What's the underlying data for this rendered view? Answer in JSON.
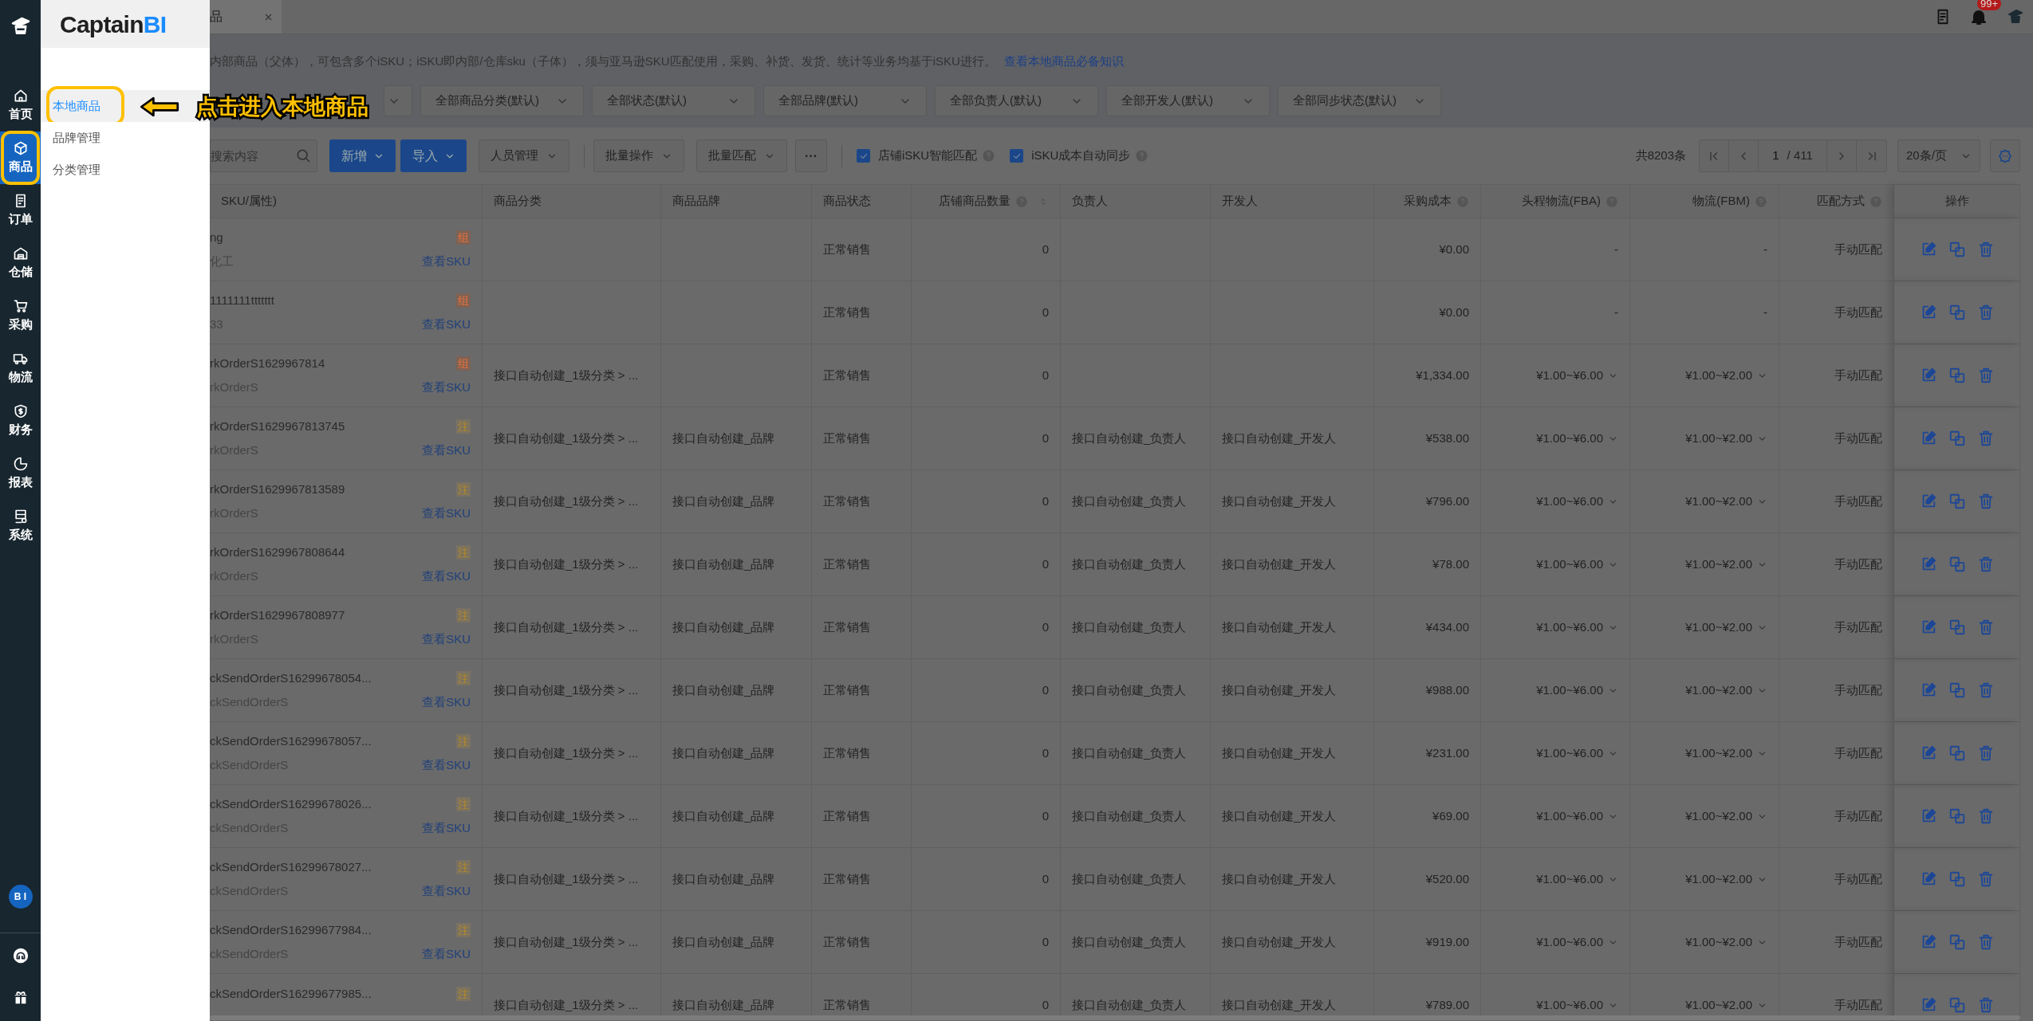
{
  "rail": {
    "items": [
      {
        "label": "首页",
        "selected": false
      },
      {
        "label": "商品",
        "selected": true
      },
      {
        "label": "订单",
        "selected": false
      },
      {
        "label": "仓储",
        "selected": false
      },
      {
        "label": "采购",
        "selected": false
      },
      {
        "label": "物流",
        "selected": false
      },
      {
        "label": "财务",
        "selected": false
      },
      {
        "label": "报表",
        "selected": false
      },
      {
        "label": "系统",
        "selected": false
      }
    ],
    "avatar": "B I"
  },
  "menu": {
    "logo": "Captain",
    "logo_accent": "BI",
    "items": [
      {
        "label": "本地商品",
        "selected": true
      },
      {
        "label": "品牌管理",
        "selected": false
      },
      {
        "label": "分类管理",
        "selected": false
      }
    ]
  },
  "annotation": {
    "text": "点击进入本地商品"
  },
  "tabs": [
    {
      "label": "品",
      "selected": true
    }
  ],
  "header": {
    "notification_badge": "99+"
  },
  "notice": {
    "text": "内部商品（父体），可包含多个iSKU；iSKU即内部/仓库sku（子体），须与亚马逊SKU匹配使用，采购、补货、发货、统计等业务均基于iSKU进行。",
    "link": "查看本地商品必备知识"
  },
  "filters": [
    "全部商品分类(默认)",
    "全部状态(默认)",
    "全部品牌(默认)",
    "全部负责人(默认)",
    "全部开发人(默认)",
    "全部同步状态(默认)"
  ],
  "toolbar": {
    "search_placeholder": "搜索内容",
    "buttons": [
      {
        "label": "新增",
        "kind": "primary"
      },
      {
        "label": "导入",
        "kind": "primary"
      },
      {
        "label": "人员管理",
        "kind": "dropdown"
      },
      {
        "label": "批量操作",
        "kind": "dropdown"
      },
      {
        "label": "批量匹配",
        "kind": "dropdown"
      },
      {
        "label": "···",
        "kind": "more"
      }
    ],
    "checkboxes": [
      {
        "label": "店铺iSKU智能匹配",
        "checked": true
      },
      {
        "label": "iSKU成本自动同步",
        "checked": true
      }
    ]
  },
  "pagination": {
    "total": "共8203条",
    "page": "1",
    "pages": "/ 411",
    "page_size": "20条/页"
  },
  "table": {
    "columns": [
      {
        "label": "SKU/属性)",
        "help": false,
        "sortable": false
      },
      {
        "label": "商品分类",
        "help": false,
        "sortable": false
      },
      {
        "label": "商品品牌",
        "help": false,
        "sortable": false
      },
      {
        "label": "商品状态",
        "help": false,
        "sortable": false
      },
      {
        "label": "店铺商品数量",
        "help": true,
        "sortable": true
      },
      {
        "label": "负责人",
        "help": false,
        "sortable": false
      },
      {
        "label": "开发人",
        "help": false,
        "sortable": false
      },
      {
        "label": "采购成本",
        "help": true,
        "sortable": false
      },
      {
        "label": "头程物流(FBA)",
        "help": true,
        "sortable": false
      },
      {
        "label": "物流(FBM)",
        "help": true,
        "sortable": false
      },
      {
        "label": "匹配方式",
        "help": true,
        "sortable": false
      },
      {
        "label": "操作",
        "help": false,
        "sortable": false
      }
    ],
    "rows": [
      {
        "name": "ng",
        "sub": "化工",
        "badge": {
          "text": "组",
          "kind": "group"
        },
        "link": "查看SKU",
        "status": "正常销售",
        "store_count": "0",
        "cost": "¥0.00",
        "fba": {
          "text": "-",
          "expandable": false
        },
        "fbm": {
          "text": "-",
          "expandable": false
        },
        "match": "手动匹配"
      },
      {
        "name": "1111111ttttttt",
        "sub": "33",
        "badge": {
          "text": "组",
          "kind": "group"
        },
        "link": "查看SKU",
        "status": "正常销售",
        "store_count": "0",
        "cost": "¥0.00",
        "fba": {
          "text": "-",
          "expandable": false
        },
        "fbm": {
          "text": "-",
          "expandable": false
        },
        "match": "手动匹配"
      },
      {
        "name": "rkOrderS1629967814",
        "sub": "rkOrderS",
        "badge": {
          "text": "组",
          "kind": "group"
        },
        "link": "查看SKU",
        "category": "接口自动创建_1级分类 > ...",
        "status": "正常销售",
        "store_count": "0",
        "cost": "¥1,334.00",
        "fba": {
          "text": "¥1.00~¥6.00",
          "expandable": true
        },
        "fbm": {
          "text": "¥1.00~¥2.00",
          "expandable": true
        },
        "match": "手动匹配"
      },
      {
        "name": "rkOrderS1629967813745",
        "sub": "rkOrderS",
        "badge": {
          "text": "注",
          "kind": "note"
        },
        "link": "查看SKU",
        "category": "接口自动创建_1级分类 > ...",
        "brand": "接口自动创建_品牌",
        "status": "正常销售",
        "store_count": "0",
        "owner": "接口自动创建_负责人",
        "developer": "接口自动创建_开发人",
        "cost": "¥538.00",
        "fba": {
          "text": "¥1.00~¥6.00",
          "expandable": true
        },
        "fbm": {
          "text": "¥1.00~¥2.00",
          "expandable": true
        },
        "match": "手动匹配"
      },
      {
        "name": "rkOrderS1629967813589",
        "sub": "rkOrderS",
        "badge": {
          "text": "注",
          "kind": "note"
        },
        "link": "查看SKU",
        "category": "接口自动创建_1级分类 > ...",
        "brand": "接口自动创建_品牌",
        "status": "正常销售",
        "store_count": "0",
        "owner": "接口自动创建_负责人",
        "developer": "接口自动创建_开发人",
        "cost": "¥796.00",
        "fba": {
          "text": "¥1.00~¥6.00",
          "expandable": true
        },
        "fbm": {
          "text": "¥1.00~¥2.00",
          "expandable": true
        },
        "match": "手动匹配"
      },
      {
        "name": "rkOrderS1629967808644",
        "sub": "rkOrderS",
        "badge": {
          "text": "注",
          "kind": "note"
        },
        "link": "查看SKU",
        "category": "接口自动创建_1级分类 > ...",
        "brand": "接口自动创建_品牌",
        "status": "正常销售",
        "store_count": "0",
        "owner": "接口自动创建_负责人",
        "developer": "接口自动创建_开发人",
        "cost": "¥78.00",
        "fba": {
          "text": "¥1.00~¥6.00",
          "expandable": true
        },
        "fbm": {
          "text": "¥1.00~¥2.00",
          "expandable": true
        },
        "match": "手动匹配"
      },
      {
        "name": "rkOrderS1629967808977",
        "sub": "rkOrderS",
        "badge": {
          "text": "注",
          "kind": "note"
        },
        "link": "查看SKU",
        "category": "接口自动创建_1级分类 > ...",
        "brand": "接口自动创建_品牌",
        "status": "正常销售",
        "store_count": "0",
        "owner": "接口自动创建_负责人",
        "developer": "接口自动创建_开发人",
        "cost": "¥434.00",
        "fba": {
          "text": "¥1.00~¥6.00",
          "expandable": true
        },
        "fbm": {
          "text": "¥1.00~¥2.00",
          "expandable": true
        },
        "match": "手动匹配"
      },
      {
        "name": "ckSendOrderS16299678054...",
        "sub": "ckSendOrderS",
        "badge": {
          "text": "注",
          "kind": "note"
        },
        "link": "查看SKU",
        "category": "接口自动创建_1级分类 > ...",
        "brand": "接口自动创建_品牌",
        "status": "正常销售",
        "store_count": "0",
        "owner": "接口自动创建_负责人",
        "developer": "接口自动创建_开发人",
        "cost": "¥988.00",
        "fba": {
          "text": "¥1.00~¥6.00",
          "expandable": true
        },
        "fbm": {
          "text": "¥1.00~¥2.00",
          "expandable": true
        },
        "match": "手动匹配"
      },
      {
        "name": "ckSendOrderS16299678057...",
        "sub": "ckSendOrderS",
        "badge": {
          "text": "注",
          "kind": "note"
        },
        "link": "查看SKU",
        "category": "接口自动创建_1级分类 > ...",
        "brand": "接口自动创建_品牌",
        "status": "正常销售",
        "store_count": "0",
        "owner": "接口自动创建_负责人",
        "developer": "接口自动创建_开发人",
        "cost": "¥231.00",
        "fba": {
          "text": "¥1.00~¥6.00",
          "expandable": true
        },
        "fbm": {
          "text": "¥1.00~¥2.00",
          "expandable": true
        },
        "match": "手动匹配"
      },
      {
        "name": "ckSendOrderS16299678026...",
        "sub": "ckSendOrderS",
        "badge": {
          "text": "注",
          "kind": "note"
        },
        "link": "查看SKU",
        "category": "接口自动创建_1级分类 > ...",
        "brand": "接口自动创建_品牌",
        "status": "正常销售",
        "store_count": "0",
        "owner": "接口自动创建_负责人",
        "developer": "接口自动创建_开发人",
        "cost": "¥69.00",
        "fba": {
          "text": "¥1.00~¥6.00",
          "expandable": true
        },
        "fbm": {
          "text": "¥1.00~¥2.00",
          "expandable": true
        },
        "match": "手动匹配"
      },
      {
        "name": "ckSendOrderS16299678027...",
        "sub": "ckSendOrderS",
        "badge": {
          "text": "注",
          "kind": "note"
        },
        "link": "查看SKU",
        "category": "接口自动创建_1级分类 > ...",
        "brand": "接口自动创建_品牌",
        "status": "正常销售",
        "store_count": "0",
        "owner": "接口自动创建_负责人",
        "developer": "接口自动创建_开发人",
        "cost": "¥520.00",
        "fba": {
          "text": "¥1.00~¥6.00",
          "expandable": true
        },
        "fbm": {
          "text": "¥1.00~¥2.00",
          "expandable": true
        },
        "match": "手动匹配"
      },
      {
        "name": "ckSendOrderS16299677984...",
        "sub": "ckSendOrderS",
        "badge": {
          "text": "注",
          "kind": "note"
        },
        "link": "查看SKU",
        "category": "接口自动创建_1级分类 > ...",
        "brand": "接口自动创建_品牌",
        "status": "正常销售",
        "store_count": "0",
        "owner": "接口自动创建_负责人",
        "developer": "接口自动创建_开发人",
        "cost": "¥919.00",
        "fba": {
          "text": "¥1.00~¥6.00",
          "expandable": true
        },
        "fbm": {
          "text": "¥1.00~¥2.00",
          "expandable": true
        },
        "match": "手动匹配"
      },
      {
        "name": "ckSendOrderS16299677985...",
        "badge": {
          "text": "注",
          "kind": "note"
        },
        "category": "接口自动创建_1级分类 > ...",
        "brand": "接口自动创建_品牌",
        "status": "正常销售",
        "store_count": "0",
        "owner": "接口自动创建_负责人",
        "developer": "接口自动创建_开发人",
        "cost": "¥789.00",
        "fba": {
          "text": "¥1.00~¥6.00",
          "expandable": true
        },
        "fbm": {
          "text": "¥1.00~¥2.00",
          "expandable": true
        },
        "match": "手动匹配"
      }
    ]
  }
}
